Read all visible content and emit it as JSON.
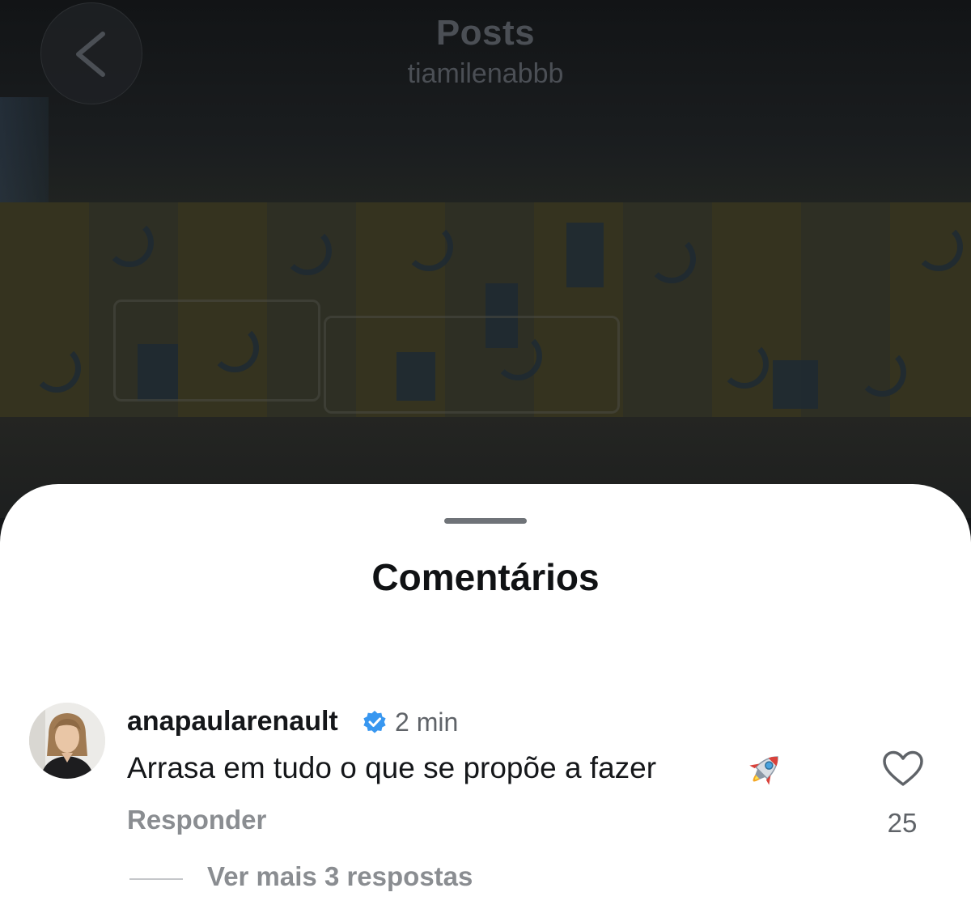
{
  "header": {
    "title": "Posts",
    "subtitle": "tiamilenabbb",
    "back_icon": "chevron-left-icon"
  },
  "comments_sheet": {
    "title": "Comentários",
    "comment": {
      "username": "anapaularenault",
      "verified": true,
      "verified_color": "#3897f0",
      "time": "2 min",
      "text": "Arrasa em tudo o que se propõe a fazer",
      "emoji": "rocket-emoji",
      "reply_label": "Responder",
      "like_icon": "heart-outline-icon",
      "like_count": "25",
      "view_replies_label": "Ver mais 3 respostas"
    }
  },
  "colors": {
    "sheet_background": "#ffffff",
    "muted_text": "#8a8d91",
    "primary_text": "#15171a"
  }
}
